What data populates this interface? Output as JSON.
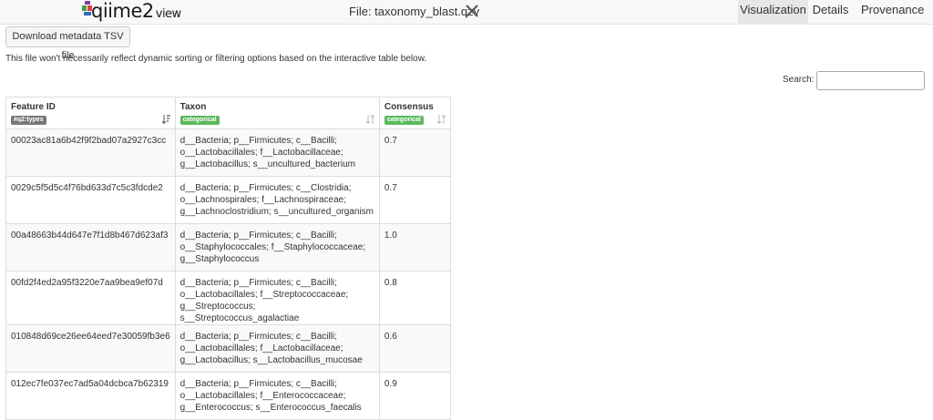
{
  "app": {
    "logo": {
      "main": "qiime2",
      "suffix": "view"
    },
    "file_title": "File: taxonomy_blast.qzv",
    "tabs": [
      {
        "label": "Visualization",
        "active": true
      },
      {
        "label": "Details",
        "active": false
      },
      {
        "label": "Provenance",
        "active": false
      }
    ]
  },
  "toolbar": {
    "download_label": "Download metadata TSV file",
    "note": "This file won't necessarily reflect dynamic sorting or filtering options based on the interactive table below."
  },
  "search": {
    "label": "Search:",
    "value": ""
  },
  "table": {
    "columns": [
      {
        "title": "Feature ID",
        "badge": "#q2:types"
      },
      {
        "title": "Taxon",
        "badge": "categorical"
      },
      {
        "title": "Consensus",
        "badge": "categorical"
      }
    ],
    "rows": [
      {
        "id": "00023ac81a6b42f9f2bad07a2927c3cc",
        "taxon": [
          "d__Bacteria; p__Firmicutes; c__Bacilli;",
          "o__Lactobacillales; f__Lactobacillaceae;",
          "g__Lactobacillus; s__uncultured_bacterium"
        ],
        "consensus": "0.7"
      },
      {
        "id": "0029c5f5d5c4f76bd633d7c5c3fdcde2",
        "taxon": [
          "d__Bacteria; p__Firmicutes; c__Clostridia;",
          "o__Lachnospirales; f__Lachnospiraceae;",
          "g__Lachnoclostridium; s__uncultured_organism"
        ],
        "consensus": "0.7"
      },
      {
        "id": "00a48663b44d647e7f1d8b467d623af3",
        "taxon": [
          "d__Bacteria; p__Firmicutes; c__Bacilli;",
          "o__Staphylococcales; f__Staphylococcaceae;",
          "g__Staphylococcus"
        ],
        "consensus": "1.0"
      },
      {
        "id": "00fd2f4ed2a95f3220e7aa9bea9ef07d",
        "taxon": [
          "d__Bacteria; p__Firmicutes; c__Bacilli;",
          "o__Lactobacillales; f__Streptococcaceae;",
          "g__Streptococcus; s__Streptococcus_agalactiae"
        ],
        "consensus": "0.8"
      },
      {
        "id": "010848d69ce26ee64eed7e30059fb3e6",
        "taxon": [
          "d__Bacteria; p__Firmicutes; c__Bacilli;",
          "o__Lactobacillales; f__Lactobacillaceae;",
          "g__Lactobacillus; s__Lactobacillus_mucosae"
        ],
        "consensus": "0.6"
      },
      {
        "id": "012ec7fe037ec7ad5a04dcbca7b62319",
        "taxon": [
          "d__Bacteria; p__Firmicutes; c__Bacilli;",
          "o__Lactobacillales; f__Enterococcaceae;",
          "g__Enterococcus; s__Enterococcus_faecalis"
        ],
        "consensus": "0.9"
      }
    ]
  },
  "icons": {
    "close": "close-icon",
    "sort_active": "sort-asc-icon",
    "sort_inactive": "sort-both-icon"
  },
  "colors": {
    "badge_types": "#777777",
    "badge_categorical": "#5cb85c",
    "active_tab": "#e7e7e7"
  }
}
